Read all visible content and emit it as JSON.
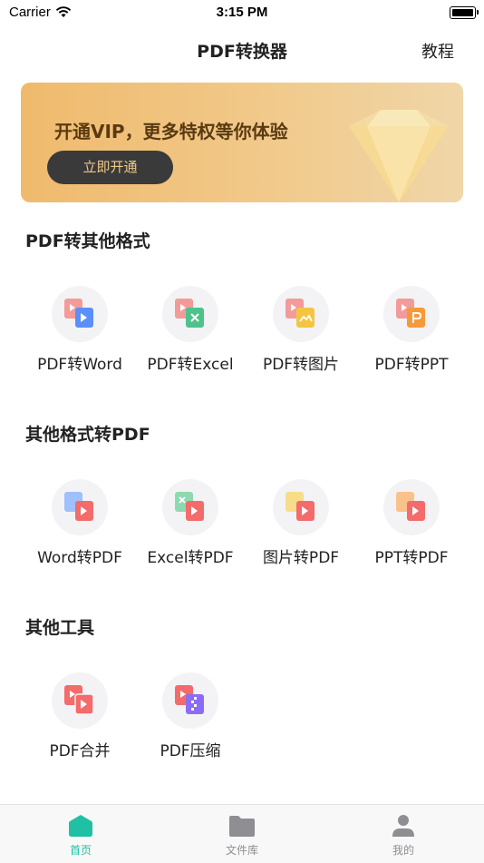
{
  "status": {
    "carrier": "Carrier",
    "time": "3:15 PM"
  },
  "nav": {
    "title": "PDF转换器",
    "right": "教程"
  },
  "banner": {
    "text": "开通VIP，更多特权等你体验",
    "button": "立即开通"
  },
  "sections": [
    {
      "title": "PDF转其他格式",
      "items": [
        {
          "label": "PDF转Word",
          "icon": "pdf-to-word-icon"
        },
        {
          "label": "PDF转Excel",
          "icon": "pdf-to-excel-icon"
        },
        {
          "label": "PDF转图片",
          "icon": "pdf-to-image-icon"
        },
        {
          "label": "PDF转PPT",
          "icon": "pdf-to-ppt-icon"
        }
      ]
    },
    {
      "title": "其他格式转PDF",
      "items": [
        {
          "label": "Word转PDF",
          "icon": "word-to-pdf-icon"
        },
        {
          "label": "Excel转PDF",
          "icon": "excel-to-pdf-icon"
        },
        {
          "label": "图片转PDF",
          "icon": "image-to-pdf-icon"
        },
        {
          "label": "PPT转PDF",
          "icon": "ppt-to-pdf-icon"
        }
      ]
    },
    {
      "title": "其他工具",
      "items": [
        {
          "label": "PDF合并",
          "icon": "pdf-merge-icon"
        },
        {
          "label": "PDF压缩",
          "icon": "pdf-compress-icon"
        }
      ]
    }
  ],
  "tabs": [
    {
      "label": "首页",
      "icon": "home-icon",
      "active": true
    },
    {
      "label": "文件库",
      "icon": "folder-icon",
      "active": false
    },
    {
      "label": "我的",
      "icon": "person-icon",
      "active": false
    }
  ],
  "colors": {
    "accent": "#1fc0a4",
    "pdf": "#f36b6b",
    "word": "#5b8ff9",
    "excel": "#4cc38a",
    "image": "#f5c542",
    "ppt": "#f59a3a",
    "compress": "#8b6cf6"
  }
}
